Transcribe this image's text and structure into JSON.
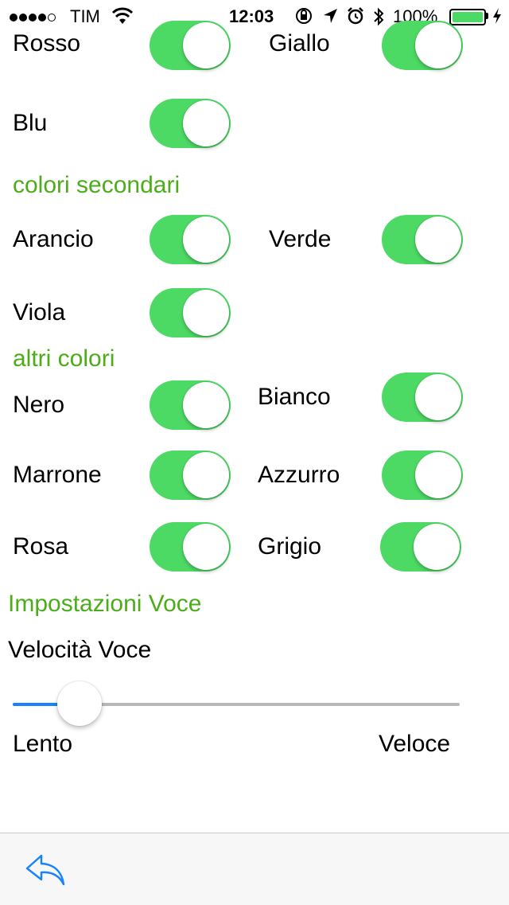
{
  "status_bar": {
    "carrier": "TIM",
    "time": "12:03",
    "battery_percent": "100%",
    "battery_level": 1.0,
    "signal_bars_filled": 4,
    "signal_bars_total": 5,
    "icons": [
      "wifi-icon",
      "rotation-lock-icon",
      "location-icon",
      "alarm-icon",
      "bluetooth-icon",
      "charging-icon"
    ]
  },
  "colors": {
    "section_title": "#4cac1a",
    "switch_on": "#4cd964",
    "slider_fill": "#1a82fb",
    "icon_blue": "#1a82fb"
  },
  "primary": {
    "items": [
      {
        "label": "Rosso",
        "on": true
      },
      {
        "label": "Giallo",
        "on": true
      },
      {
        "label": "Blu",
        "on": true
      }
    ]
  },
  "secondary": {
    "title": "colori secondari",
    "items": [
      {
        "label": "Arancio",
        "on": true
      },
      {
        "label": "Verde",
        "on": true
      },
      {
        "label": "Viola",
        "on": true
      }
    ]
  },
  "others": {
    "title": "altri colori",
    "items": [
      {
        "label": "Nero",
        "on": true
      },
      {
        "label": "Bianco",
        "on": true
      },
      {
        "label": "Marrone",
        "on": true
      },
      {
        "label": "Azzurro",
        "on": true
      },
      {
        "label": "Rosa",
        "on": true
      },
      {
        "label": "Grigio",
        "on": true
      }
    ]
  },
  "voice": {
    "title": "Impostazioni Voce",
    "speed_label": "Velocità Voce",
    "slider_value": 0.11,
    "min_label": "Lento",
    "max_label": "Veloce"
  },
  "toolbar": {
    "back_icon": "reply-arrow-icon"
  }
}
